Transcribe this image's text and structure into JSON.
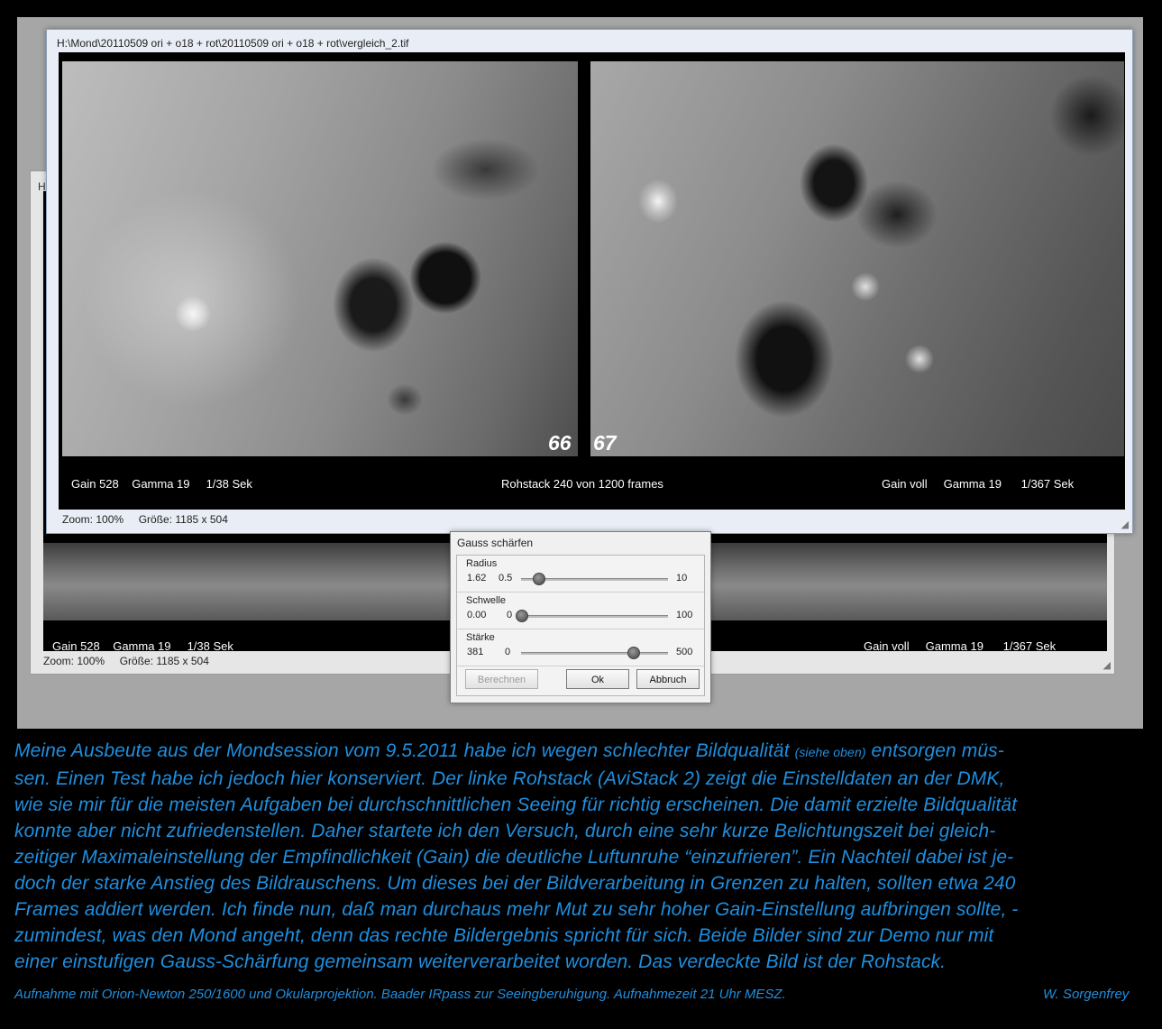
{
  "back_window": {
    "title": "H:",
    "info_left": "Gain 528    Gamma 19     1/38 Sek",
    "info_right": "Gain voll     Gamma 19      1/367 Sek",
    "status": "Zoom: 100%     Größe: 1185 x 504"
  },
  "front_window": {
    "title": "H:\\Mond\\20110509 ori + o18 + rot\\20110509 ori + o18 + rot\\vergleich_2.tif",
    "frame_left": "66",
    "frame_right": "67",
    "info_left": "Gain 528    Gamma 19     1/38 Sek",
    "info_center": "Rohstack 240 von 1200 frames",
    "info_right": "Gain voll     Gamma 19      1/367 Sek",
    "status": "Zoom: 100%     Größe: 1185 x 504"
  },
  "dialog": {
    "title": "Gauss schärfen",
    "radius": {
      "label": "Radius",
      "value": "1.62",
      "min": "0.5",
      "max": "10",
      "level": 0.118
    },
    "schwelle": {
      "label": "Schwelle",
      "value": "0.00",
      "min": "0",
      "max": "100",
      "level": 0.0
    },
    "staerke": {
      "label": "Stärke",
      "value": "381",
      "min": "0",
      "max": "500",
      "level": 0.762
    },
    "buttons": {
      "berechnen": "Berechnen",
      "ok": "Ok",
      "abbruch": "Abbruch"
    }
  },
  "caption": {
    "lines": [
      [
        "Meine Ausbeute aus der Mondsession vom 9.5.2011 habe ich wegen schlechter Bildqualität ",
        "(siehe oben)",
        " entsorgen müs-"
      ],
      [
        "sen. Einen Test habe ich jedoch hier konserviert. Der linke Rohstack (AviStack 2) zeigt die Einstelldaten an der DMK,"
      ],
      [
        "wie sie mir für die meisten Aufgaben bei durchschnittlichen Seeing für richtig erscheinen. Die damit erzielte Bildqualität"
      ],
      [
        "konnte aber nicht zufriedenstellen. Daher startete ich den Versuch, durch eine sehr kurze Belichtungszeit bei gleich-"
      ],
      [
        "zeitiger Maximaleinstellung der Empfindlichkeit (Gain) die deutliche Luftunruhe “einzufrieren”. Ein Nachteil dabei ist je-"
      ],
      [
        "doch der starke Anstieg des Bildrauschens. Um dieses bei der Bildverarbeitung in Grenzen zu halten, sollten etwa 240"
      ],
      [
        "Frames addiert werden. Ich finde nun, daß man durchaus mehr Mut zu sehr hoher Gain-Einstellung aufbringen sollte, -"
      ],
      [
        "zumindest, was den Mond angeht, denn das rechte Bildergebnis spricht für sich. Beide Bilder sind zur Demo nur mit"
      ],
      [
        "einer einstufigen Gauss-Schärfung gemeinsam weiterverarbeitet worden. Das verdeckte Bild ist der Rohstack."
      ]
    ]
  },
  "footer": {
    "left": "Aufnahme mit Orion-Newton 250/1600 und Okularprojektion. Baader IRpass zur Seeingberuhigung. Aufnahmezeit 21 Uhr MESZ.",
    "right": "W. Sorgenfrey"
  }
}
